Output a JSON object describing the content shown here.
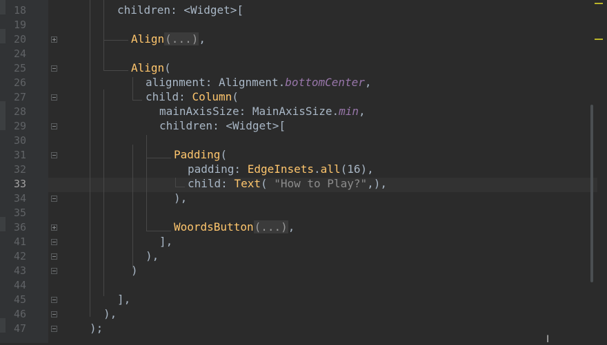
{
  "editor": {
    "line_numbers": [
      "18",
      "19",
      "20",
      "24",
      "25",
      "26",
      "27",
      "28",
      "29",
      "30",
      "31",
      "32",
      "33",
      "34",
      "35",
      "36",
      "41",
      "42",
      "43",
      "44",
      "45",
      "46",
      "47"
    ],
    "current_line": "33",
    "lines": {
      "l18": "children: <Widget>[",
      "l20_fn": "Align",
      "l20_fold": "(...)",
      "l20_end": ",",
      "l25_fn": "Align",
      "l25_end": "(",
      "l26_prop": "alignment: Alignment.",
      "l26_val": "bottomCenter",
      "l26_end": ",",
      "l27_prop": "child: ",
      "l27_fn": "Column",
      "l27_end": "(",
      "l28_prop": "mainAxisSize: MainAxisSize.",
      "l28_val": "min",
      "l28_end": ",",
      "l29": "children: <Widget>[",
      "l31_fn": "Padding",
      "l31_end": "(",
      "l32_prop": "padding: ",
      "l32_fn1": "EdgeInsets",
      "l32_dot": ".",
      "l32_fn2": "all",
      "l32_paren": "(",
      "l32_num": "16",
      "l32_end": "),",
      "l33_prop": "child: ",
      "l33_fn": "Text",
      "l33_paren": "( ",
      "l33_str": "\"How to Play?\"",
      "l33_end": ",),",
      "l34": "),",
      "l36_fn": "WoordsButton",
      "l36_fold": "(...)",
      "l36_end": ",",
      "l41": "],",
      "l42": "),",
      "l43": ")",
      "l45": "],",
      "l46": "),",
      "l47": ");"
    }
  },
  "cursor_icon": "text-cursor-icon",
  "colors": {
    "background": "#2b2b2b",
    "gutter": "#313335",
    "function": "#ffc66d",
    "text": "#a9b7c6",
    "italic_member": "#9876aa"
  }
}
